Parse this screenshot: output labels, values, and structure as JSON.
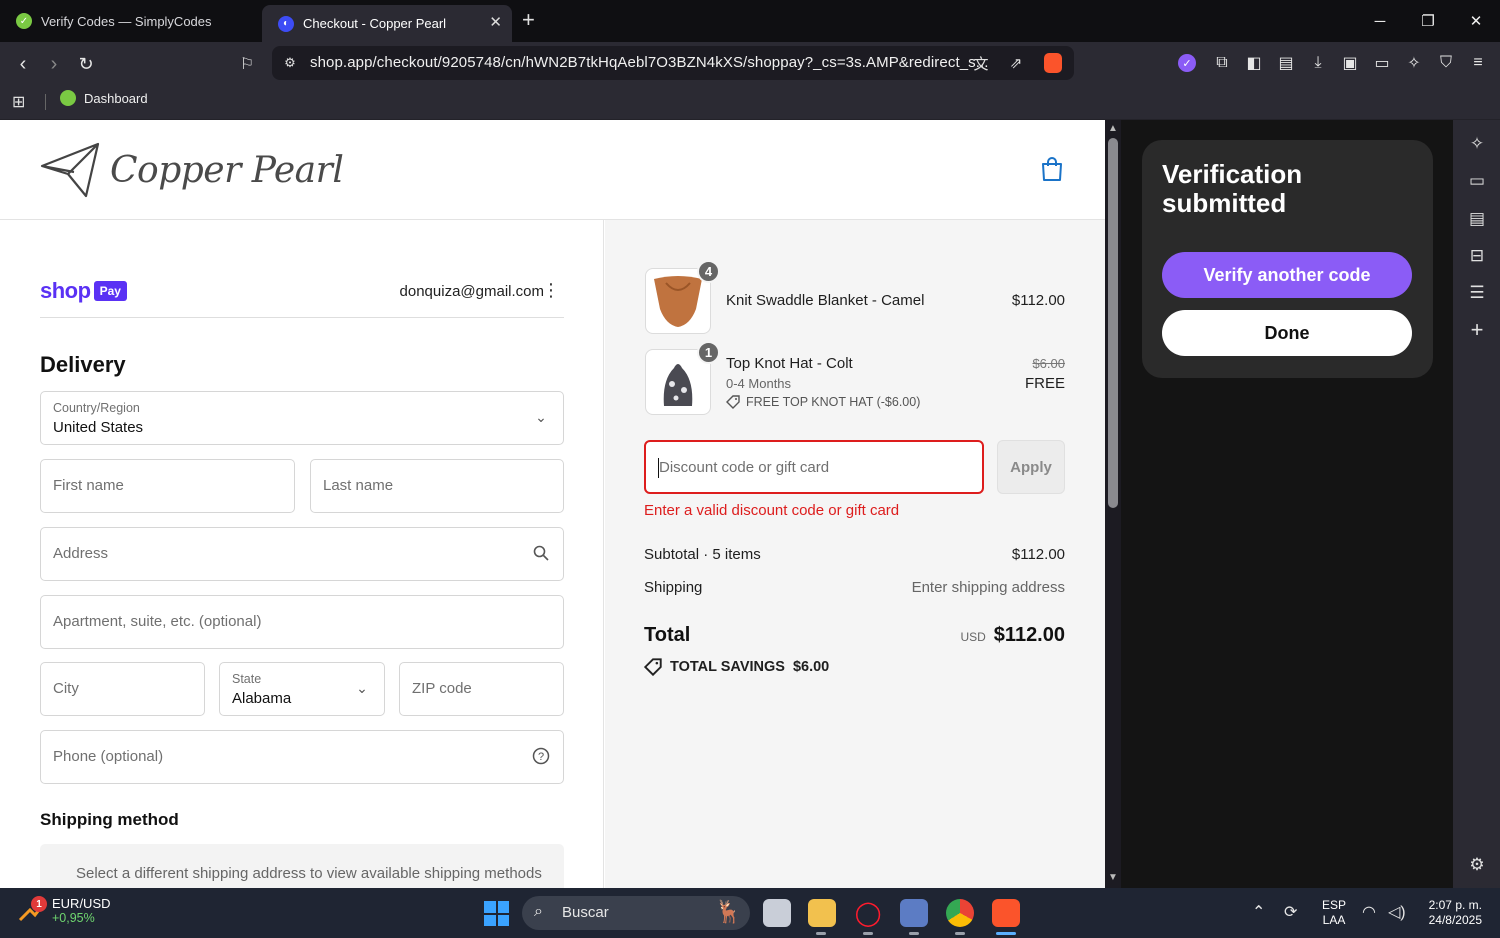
{
  "browser": {
    "tabs": [
      {
        "title": "Verify Codes — SimplyCodes",
        "active": false
      },
      {
        "title": "Checkout - Copper Pearl",
        "active": true
      }
    ],
    "url": "shop.app/checkout/9205748/cn/hWN2B7tkHqAebl7O3BZN4kXS/shoppay?_cs=3s.AMP&redirect_s...",
    "bookmarks": [
      {
        "label": "Dashboard"
      }
    ]
  },
  "store": {
    "logo_text": "Copper Pearl"
  },
  "shoppay": {
    "shop_word": "shop",
    "pay_badge": "Pay",
    "email": "donquiza@gmail.com"
  },
  "delivery": {
    "heading": "Delivery",
    "country_label": "Country/Region",
    "country_value": "United States",
    "first_name_ph": "First name",
    "last_name_ph": "Last name",
    "address_ph": "Address",
    "apartment_ph": "Apartment, suite, etc. (optional)",
    "city_ph": "City",
    "state_label": "State",
    "state_value": "Alabama",
    "zip_ph": "ZIP code",
    "phone_ph": "Phone (optional)"
  },
  "shipping_method": {
    "heading": "Shipping method",
    "notice": "Select a different shipping address to view available shipping methods"
  },
  "order": {
    "items": [
      {
        "name": "Knit Swaddle Blanket - Camel",
        "qty": "4",
        "price": "$112.00"
      },
      {
        "name": "Top Knot Hat - Colt",
        "qty": "1",
        "variant": "0-4 Months",
        "discount": "FREE TOP KNOT HAT (-$6.00)",
        "orig_price": "$6.00",
        "price": "FREE"
      }
    ],
    "discount_ph": "Discount code or gift card",
    "apply_label": "Apply",
    "discount_error": "Enter a valid discount code or gift card",
    "subtotal_label": "Subtotal · 5 items",
    "subtotal_value": "$112.00",
    "shipping_label": "Shipping",
    "shipping_value": "Enter shipping address",
    "total_label": "Total",
    "total_currency": "USD",
    "total_value": "$112.00",
    "savings_label": "TOTAL SAVINGS",
    "savings_value": "$6.00"
  },
  "side_panel": {
    "title": "Verification submitted",
    "verify_another": "Verify another code",
    "done": "Done"
  },
  "taskbar": {
    "ticker_pair": "EUR/USD",
    "ticker_change": "+0,95%",
    "ticker_badge": "1",
    "search_label": "Buscar",
    "lang_1": "ESP",
    "lang_2": "LAA",
    "time": "2:07 p. m.",
    "date": "24/8/2025"
  },
  "colors": {
    "shoppay_purple": "#5a31f4",
    "error_red": "#dd1d1d",
    "verify_purple": "#8b5cf6"
  }
}
